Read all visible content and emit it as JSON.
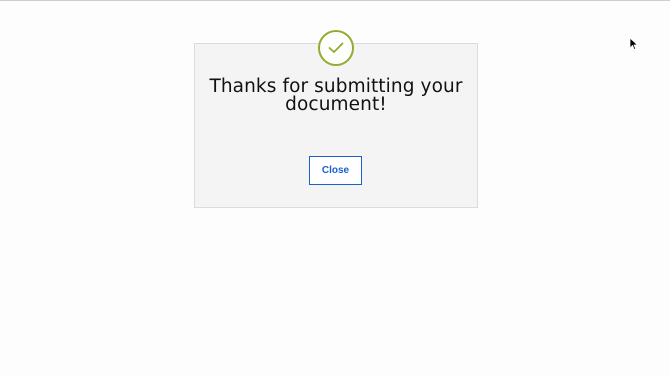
{
  "dialog": {
    "title": "Thanks for submitting your document!",
    "close_label": "Close",
    "icon": "checkmark-circle-icon"
  },
  "colors": {
    "accent_green": "#8fad2a",
    "button_blue": "#1a5fd0",
    "dialog_bg": "#f4f4f4"
  }
}
